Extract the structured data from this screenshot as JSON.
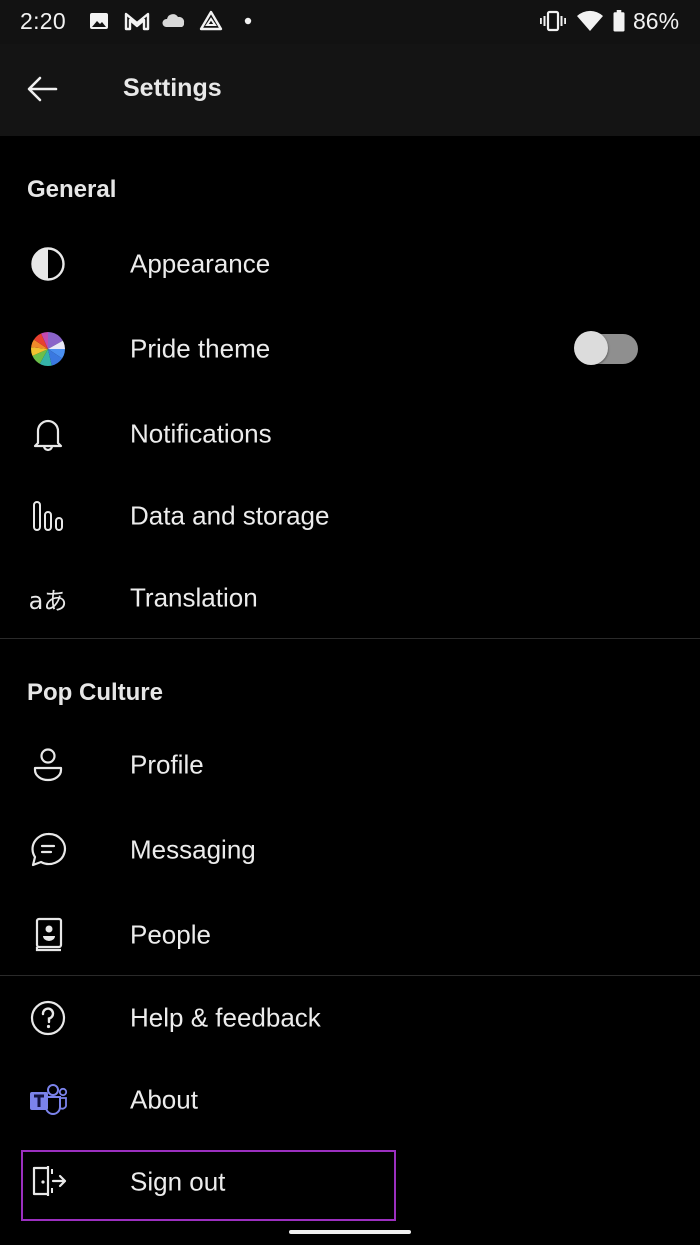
{
  "status_bar": {
    "time": "2:20",
    "notification_icons": [
      "gallery-icon",
      "gmail-icon",
      "onedrive-cloud-icon",
      "drive-icon",
      "dot-icon"
    ],
    "system_icons": [
      "vibrate-icon",
      "wifi-icon",
      "battery-icon"
    ],
    "battery_percent": "86%"
  },
  "app_bar": {
    "back_icon": "arrow-left-icon",
    "title": "Settings"
  },
  "sections": [
    {
      "header": "General",
      "items": [
        {
          "label": "Appearance",
          "icon": "contrast-icon"
        },
        {
          "label": "Pride theme",
          "icon": "pride-color-wheel-icon",
          "toggle": {
            "on": false
          }
        },
        {
          "label": "Notifications",
          "icon": "bell-icon"
        },
        {
          "label": "Data and storage",
          "icon": "data-bars-icon"
        },
        {
          "label": "Translation",
          "icon": "translate-icon"
        }
      ]
    },
    {
      "header": "Pop Culture",
      "items": [
        {
          "label": "Profile",
          "icon": "person-icon"
        },
        {
          "label": "Messaging",
          "icon": "chat-bubble-icon"
        },
        {
          "label": "People",
          "icon": "contact-book-icon"
        }
      ]
    },
    {
      "header": "",
      "items": [
        {
          "label": "Help & feedback",
          "icon": "help-circle-icon"
        },
        {
          "label": "About",
          "icon": "teams-logo-icon"
        },
        {
          "label": "Sign out",
          "icon": "sign-out-door-icon",
          "highlighted": true
        }
      ]
    }
  ],
  "colors": {
    "background": "#000000",
    "app_bar": "#141414",
    "highlight_border": "#9b2fbf",
    "teams_purple": "#7b83eb"
  }
}
